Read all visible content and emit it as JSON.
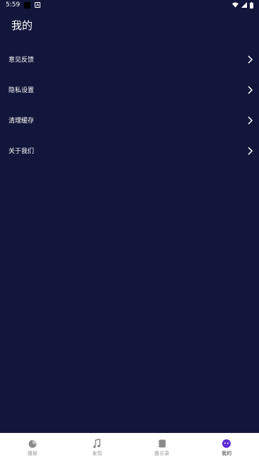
{
  "status_bar": {
    "time": "5:59"
  },
  "header": {
    "title": "我的"
  },
  "menu": {
    "items": [
      {
        "label": "意见反馈"
      },
      {
        "label": "隐私设置"
      },
      {
        "label": "清理缓存"
      },
      {
        "label": "关于我们"
      }
    ]
  },
  "bottom_nav": {
    "items": [
      {
        "label": "播报",
        "icon": "chart-icon"
      },
      {
        "label": "发现",
        "icon": "music-icon"
      },
      {
        "label": "备忘录",
        "icon": "notebook-icon"
      },
      {
        "label": "我的",
        "icon": "profile-icon",
        "active": true
      }
    ]
  },
  "colors": {
    "background": "#12163a",
    "accent": "#5b2bd6",
    "nav_bg": "#ffffff"
  }
}
